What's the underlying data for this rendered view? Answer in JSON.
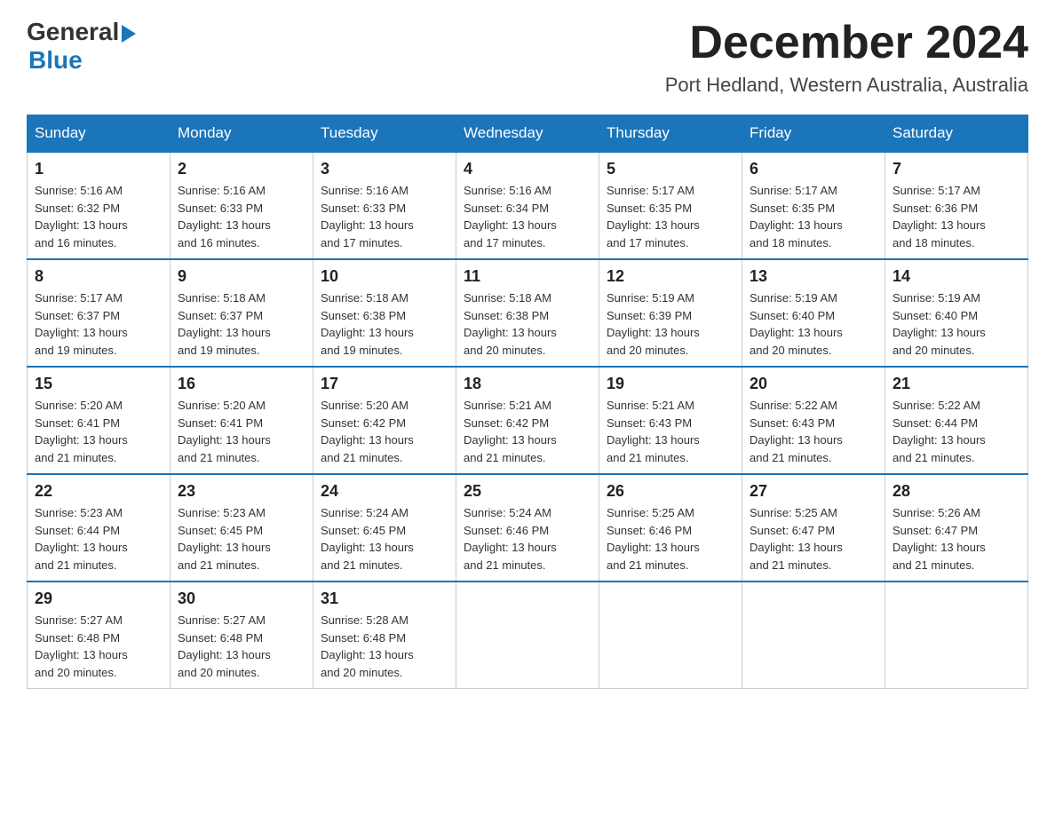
{
  "header": {
    "logo_general": "General",
    "logo_blue": "Blue",
    "month_title": "December 2024",
    "location": "Port Hedland, Western Australia, Australia"
  },
  "calendar": {
    "days_of_week": [
      "Sunday",
      "Monday",
      "Tuesday",
      "Wednesday",
      "Thursday",
      "Friday",
      "Saturday"
    ],
    "weeks": [
      [
        {
          "day": "1",
          "sunrise": "5:16 AM",
          "sunset": "6:32 PM",
          "daylight": "13 hours and 16 minutes."
        },
        {
          "day": "2",
          "sunrise": "5:16 AM",
          "sunset": "6:33 PM",
          "daylight": "13 hours and 16 minutes."
        },
        {
          "day": "3",
          "sunrise": "5:16 AM",
          "sunset": "6:33 PM",
          "daylight": "13 hours and 17 minutes."
        },
        {
          "day": "4",
          "sunrise": "5:16 AM",
          "sunset": "6:34 PM",
          "daylight": "13 hours and 17 minutes."
        },
        {
          "day": "5",
          "sunrise": "5:17 AM",
          "sunset": "6:35 PM",
          "daylight": "13 hours and 17 minutes."
        },
        {
          "day": "6",
          "sunrise": "5:17 AM",
          "sunset": "6:35 PM",
          "daylight": "13 hours and 18 minutes."
        },
        {
          "day": "7",
          "sunrise": "5:17 AM",
          "sunset": "6:36 PM",
          "daylight": "13 hours and 18 minutes."
        }
      ],
      [
        {
          "day": "8",
          "sunrise": "5:17 AM",
          "sunset": "6:37 PM",
          "daylight": "13 hours and 19 minutes."
        },
        {
          "day": "9",
          "sunrise": "5:18 AM",
          "sunset": "6:37 PM",
          "daylight": "13 hours and 19 minutes."
        },
        {
          "day": "10",
          "sunrise": "5:18 AM",
          "sunset": "6:38 PM",
          "daylight": "13 hours and 19 minutes."
        },
        {
          "day": "11",
          "sunrise": "5:18 AM",
          "sunset": "6:38 PM",
          "daylight": "13 hours and 20 minutes."
        },
        {
          "day": "12",
          "sunrise": "5:19 AM",
          "sunset": "6:39 PM",
          "daylight": "13 hours and 20 minutes."
        },
        {
          "day": "13",
          "sunrise": "5:19 AM",
          "sunset": "6:40 PM",
          "daylight": "13 hours and 20 minutes."
        },
        {
          "day": "14",
          "sunrise": "5:19 AM",
          "sunset": "6:40 PM",
          "daylight": "13 hours and 20 minutes."
        }
      ],
      [
        {
          "day": "15",
          "sunrise": "5:20 AM",
          "sunset": "6:41 PM",
          "daylight": "13 hours and 21 minutes."
        },
        {
          "day": "16",
          "sunrise": "5:20 AM",
          "sunset": "6:41 PM",
          "daylight": "13 hours and 21 minutes."
        },
        {
          "day": "17",
          "sunrise": "5:20 AM",
          "sunset": "6:42 PM",
          "daylight": "13 hours and 21 minutes."
        },
        {
          "day": "18",
          "sunrise": "5:21 AM",
          "sunset": "6:42 PM",
          "daylight": "13 hours and 21 minutes."
        },
        {
          "day": "19",
          "sunrise": "5:21 AM",
          "sunset": "6:43 PM",
          "daylight": "13 hours and 21 minutes."
        },
        {
          "day": "20",
          "sunrise": "5:22 AM",
          "sunset": "6:43 PM",
          "daylight": "13 hours and 21 minutes."
        },
        {
          "day": "21",
          "sunrise": "5:22 AM",
          "sunset": "6:44 PM",
          "daylight": "13 hours and 21 minutes."
        }
      ],
      [
        {
          "day": "22",
          "sunrise": "5:23 AM",
          "sunset": "6:44 PM",
          "daylight": "13 hours and 21 minutes."
        },
        {
          "day": "23",
          "sunrise": "5:23 AM",
          "sunset": "6:45 PM",
          "daylight": "13 hours and 21 minutes."
        },
        {
          "day": "24",
          "sunrise": "5:24 AM",
          "sunset": "6:45 PM",
          "daylight": "13 hours and 21 minutes."
        },
        {
          "day": "25",
          "sunrise": "5:24 AM",
          "sunset": "6:46 PM",
          "daylight": "13 hours and 21 minutes."
        },
        {
          "day": "26",
          "sunrise": "5:25 AM",
          "sunset": "6:46 PM",
          "daylight": "13 hours and 21 minutes."
        },
        {
          "day": "27",
          "sunrise": "5:25 AM",
          "sunset": "6:47 PM",
          "daylight": "13 hours and 21 minutes."
        },
        {
          "day": "28",
          "sunrise": "5:26 AM",
          "sunset": "6:47 PM",
          "daylight": "13 hours and 21 minutes."
        }
      ],
      [
        {
          "day": "29",
          "sunrise": "5:27 AM",
          "sunset": "6:48 PM",
          "daylight": "13 hours and 20 minutes."
        },
        {
          "day": "30",
          "sunrise": "5:27 AM",
          "sunset": "6:48 PM",
          "daylight": "13 hours and 20 minutes."
        },
        {
          "day": "31",
          "sunrise": "5:28 AM",
          "sunset": "6:48 PM",
          "daylight": "13 hours and 20 minutes."
        },
        null,
        null,
        null,
        null
      ]
    ],
    "labels": {
      "sunrise": "Sunrise:",
      "sunset": "Sunset:",
      "daylight": "Daylight:"
    }
  }
}
